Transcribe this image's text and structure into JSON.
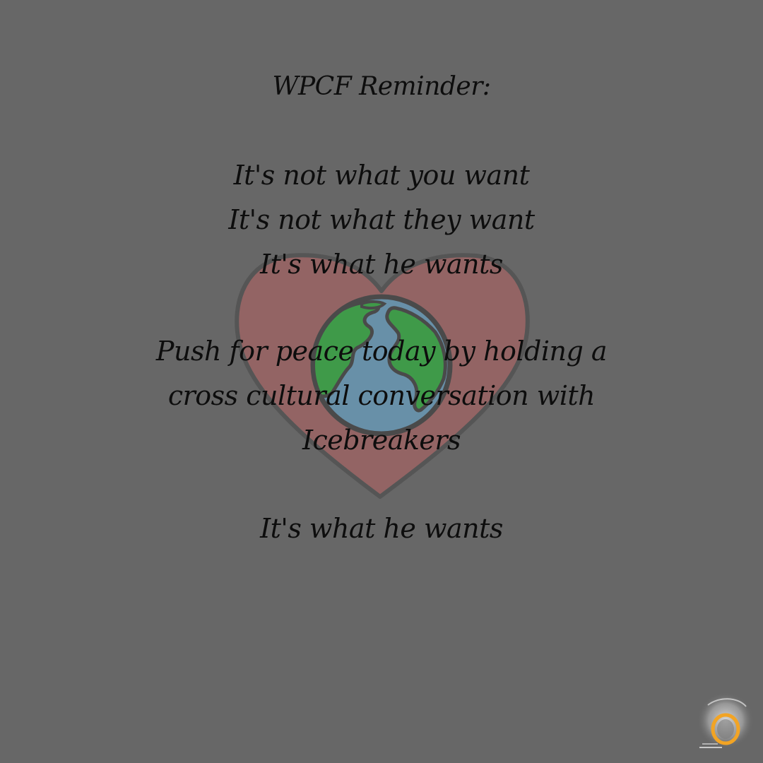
{
  "colors": {
    "background": "#676767",
    "heart_fill": "#936464",
    "heart_stroke": "#555555",
    "ocean": "#6890a8",
    "land": "#3f9a49",
    "outline": "#4a4a4a",
    "text": "#0d0d0d",
    "logo_ring": "#f2a424",
    "logo_glow": "#c9c9c9"
  },
  "poster": {
    "title": "WPCF Reminder:",
    "lines": [
      "It's not what you want",
      "It's not what they want",
      "It's what he wants",
      "Push for peace today by holding a",
      "cross cultural conversation with",
      "Icebreakers",
      "It's what he wants"
    ]
  },
  "icons": {
    "background_art": "heart-globe-icon",
    "corner_logo": "glowing-ring-logo-icon"
  }
}
